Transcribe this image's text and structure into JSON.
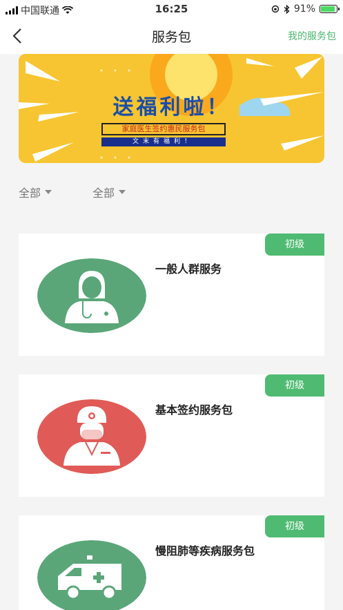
{
  "status_bar": {
    "carrier": "中国联通",
    "time": "16:25",
    "battery_percent": "91%",
    "battery_level": 0.91
  },
  "nav": {
    "title": "服务包",
    "right_link": "我的服务包",
    "back_icon": "chevron-left-icon"
  },
  "banner": {
    "title": "送福利啦！",
    "subtitle": "家庭医生签约惠民服务包",
    "tagline": "文末有福利！"
  },
  "filters": [
    {
      "label": "全部"
    },
    {
      "label": "全部"
    }
  ],
  "cards": [
    {
      "name": "一般人群服务",
      "badge": "初级",
      "icon": "doctor-female-icon",
      "icon_color": "#5aa679"
    },
    {
      "name": "基本签约服务包",
      "badge": "初级",
      "icon": "doctor-male-icon",
      "icon_color": "#e05b57"
    },
    {
      "name": "慢阻肺等疾病服务包",
      "badge": "初级",
      "icon": "ambulance-icon",
      "icon_color": "#5aa679"
    }
  ],
  "colors": {
    "accent": "#4fbb72",
    "banner_bg": "#f7c531"
  }
}
